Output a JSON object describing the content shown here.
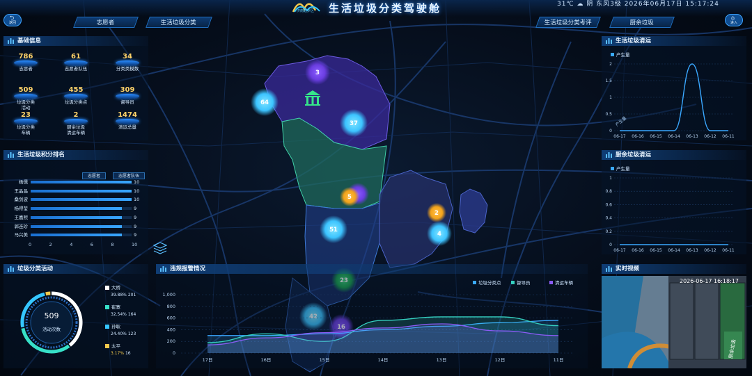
{
  "header": {
    "title": "生活垃圾分类驾驶舱",
    "logo_text": "济南起步区",
    "weather": "31℃ ☁ 阴 东风3级 2026年06月17日 15:17:24",
    "left_button": "返回",
    "right_button": "进入"
  },
  "nav_tabs": [
    "志愿者",
    "生活垃圾分类",
    "生活垃圾分类考评",
    "厨余垃圾"
  ],
  "basic_info": {
    "title": "基础信息",
    "stats": [
      {
        "value": "786",
        "label": "志愿者"
      },
      {
        "value": "61",
        "label": "志愿者队伍"
      },
      {
        "value": "34",
        "label": "分类类模数"
      },
      {
        "value": "509",
        "label": "垃圾分类\n活动"
      },
      {
        "value": "455",
        "label": "垃圾分类点"
      },
      {
        "value": "309",
        "label": "督导员"
      },
      {
        "value": "23",
        "label": "垃圾分类\n车辆"
      },
      {
        "value": "2",
        "label": "厨余垃圾\n清运车辆"
      },
      {
        "value": "1474",
        "label": "清运总量"
      }
    ]
  },
  "ranking": {
    "title": "生活垃圾积分排名",
    "toggles": [
      "志愿者",
      "志愿者队伍"
    ],
    "rows": [
      {
        "name": "杨儒",
        "score": 10
      },
      {
        "name": "王晶晶",
        "score": 10
      },
      {
        "name": "桑剑波",
        "score": 10
      },
      {
        "name": "杨得莹",
        "score": 9
      },
      {
        "name": "王嘉熙",
        "score": 9
      },
      {
        "name": "郭连珍",
        "score": 9
      },
      {
        "name": "马兴美",
        "score": 9
      }
    ],
    "axis_ticks": [
      "0",
      "2",
      "4",
      "6",
      "8",
      "10"
    ],
    "axis_max": 10
  },
  "activity": {
    "title": "垃圾分类活动",
    "center_value": "509",
    "center_label": "活动次数",
    "items": [
      {
        "name": "大桥",
        "percent": "39.88%",
        "count": "201",
        "color": "#ffffff"
      },
      {
        "name": "崔寨",
        "percent": "32.54%",
        "count": "164",
        "color": "#37e0c8"
      },
      {
        "name": "孙耿",
        "percent": "24.40%",
        "count": "123",
        "color": "#35c6ff"
      },
      {
        "name": "太平",
        "percent": "3.17%",
        "count": "16",
        "color": "#f2c94c"
      }
    ]
  },
  "alarm": {
    "title": "违规报警情况",
    "legend": [
      "垃圾分类点",
      "督导员",
      "清运车辆"
    ],
    "legend_colors": [
      "#3aa8ff",
      "#35d0c0",
      "#8b5cf6"
    ],
    "y_ticks": [
      "0",
      "200",
      "400",
      "600",
      "800",
      "1,000"
    ],
    "x_ticks": [
      "17日",
      "16日",
      "15日",
      "14日",
      "13日",
      "12日",
      "11日"
    ]
  },
  "life_clean": {
    "title": "生活垃圾清运",
    "legend": "产生量",
    "y_ticks": [
      "0",
      "0.5",
      "1",
      "1.5",
      "2"
    ],
    "x_ticks": [
      "06-17",
      "06-16",
      "06-15",
      "06-14",
      "06-13",
      "06-12",
      "06-11"
    ],
    "y_axis_word": "产生量"
  },
  "kitchen_clean": {
    "title": "厨余垃圾清运",
    "legend": "产生量",
    "y_ticks": [
      "0",
      "0.2",
      "0.4",
      "0.6",
      "0.8",
      "1"
    ],
    "x_ticks": [
      "06-17",
      "06-16",
      "06-15",
      "06-14",
      "06-13",
      "06-12",
      "06-11"
    ]
  },
  "video": {
    "title": "实时视频",
    "timestamp": "2026-06-17 16:18:17",
    "sign_text": "厨余垃圾"
  },
  "map_clusters": [
    {
      "value": "3"
    },
    {
      "value": "64"
    },
    {
      "value": "37"
    },
    {
      "value": "5"
    },
    {
      "value": "2"
    },
    {
      "value": "4"
    },
    {
      "value": "51"
    },
    {
      "value": "23"
    },
    {
      "value": "42"
    },
    {
      "value": "16"
    }
  ],
  "chart_data": [
    {
      "type": "bar",
      "title": "生活垃圾积分排名",
      "categories": [
        "杨儒",
        "王晶晶",
        "桑剑波",
        "杨得莹",
        "王嘉熙",
        "郭连珍",
        "马兴美"
      ],
      "values": [
        10,
        10,
        10,
        9,
        9,
        9,
        9
      ],
      "xlim": [
        0,
        10
      ]
    },
    {
      "type": "pie",
      "title": "垃圾分类活动",
      "categories": [
        "大桥",
        "崔寨",
        "孙耿",
        "太平"
      ],
      "values": [
        201,
        164,
        123,
        16
      ]
    },
    {
      "type": "line",
      "title": "生活垃圾清运",
      "x": [
        "06-17",
        "06-16",
        "06-15",
        "06-14",
        "06-13",
        "06-12",
        "06-11"
      ],
      "series": [
        {
          "name": "产生量",
          "values": [
            0,
            0,
            0,
            0,
            2,
            0,
            0
          ]
        }
      ],
      "ylim": [
        0,
        2
      ]
    },
    {
      "type": "line",
      "title": "厨余垃圾清运",
      "x": [
        "06-17",
        "06-16",
        "06-15",
        "06-14",
        "06-13",
        "06-12",
        "06-11"
      ],
      "series": [
        {
          "name": "产生量",
          "values": [
            0,
            0,
            0,
            0,
            0,
            0,
            0
          ]
        }
      ],
      "ylim": [
        0,
        1
      ]
    },
    {
      "type": "area",
      "title": "违规报警情况",
      "x": [
        "17日",
        "16日",
        "15日",
        "14日",
        "13日",
        "12日",
        "11日"
      ],
      "series": [
        {
          "name": "垃圾分类点",
          "values": [
            300,
            300,
            330,
            400,
            460,
            520,
            560
          ]
        },
        {
          "name": "督导员",
          "values": [
            180,
            330,
            200,
            560,
            620,
            620,
            470
          ]
        },
        {
          "name": "清运车辆",
          "values": [
            140,
            260,
            350,
            430,
            500,
            380,
            300
          ]
        }
      ],
      "ylim": [
        0,
        1000
      ]
    }
  ]
}
